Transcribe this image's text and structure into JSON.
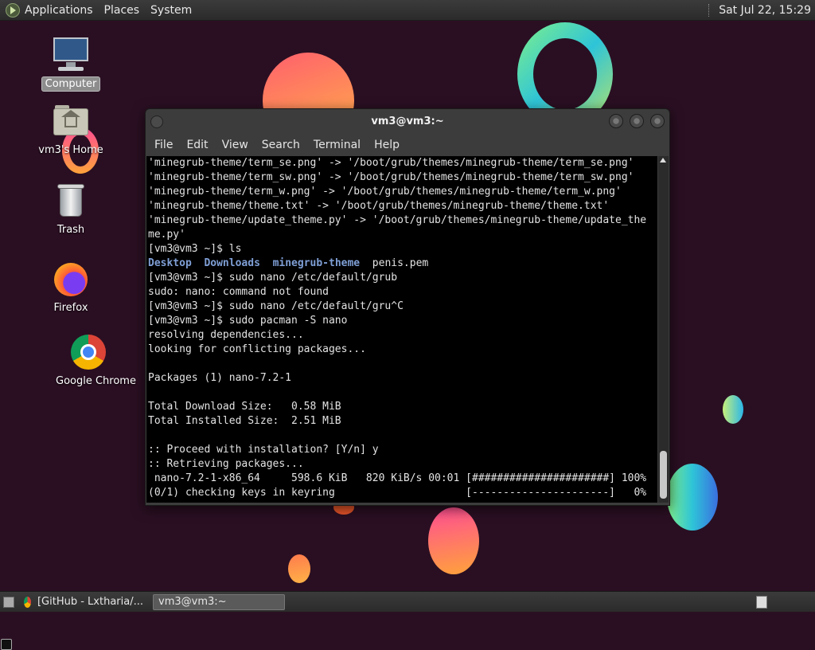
{
  "top_panel": {
    "menus": [
      "Applications",
      "Places",
      "System"
    ],
    "clock": "Sat Jul 22, 15:29"
  },
  "desktop_icons": [
    {
      "label": "Computer",
      "icon": "computer-icon"
    },
    {
      "label": "vm3's Home",
      "icon": "home-folder-icon"
    },
    {
      "label": "Trash",
      "icon": "trash-icon"
    },
    {
      "label": "Firefox",
      "icon": "firefox-icon"
    },
    {
      "label": "Google Chrome",
      "icon": "chrome-icon"
    }
  ],
  "terminal": {
    "title": "vm3@vm3:~",
    "menu": [
      "File",
      "Edit",
      "View",
      "Search",
      "Terminal",
      "Help"
    ],
    "lines": [
      "'minegrub-theme/term_se.png' -> '/boot/grub/themes/minegrub-theme/term_se.png'",
      "'minegrub-theme/term_sw.png' -> '/boot/grub/themes/minegrub-theme/term_sw.png'",
      "'minegrub-theme/term_w.png' -> '/boot/grub/themes/minegrub-theme/term_w.png'",
      "'minegrub-theme/theme.txt' -> '/boot/grub/themes/minegrub-theme/theme.txt'",
      "'minegrub-theme/update_theme.py' -> '/boot/grub/themes/minegrub-theme/update_the",
      "me.py'",
      "[vm3@vm3 ~]$ ls",
      "",
      "[vm3@vm3 ~]$ sudo nano /etc/default/grub",
      "sudo: nano: command not found",
      "[vm3@vm3 ~]$ sudo nano /etc/default/gru^C",
      "[vm3@vm3 ~]$ sudo pacman -S nano",
      "resolving dependencies...",
      "looking for conflicting packages...",
      "",
      "Packages (1) nano-7.2-1",
      "",
      "Total Download Size:   0.58 MiB",
      "Total Installed Size:  2.51 MiB",
      "",
      ":: Proceed with installation? [Y/n] y",
      ":: Retrieving packages...",
      " nano-7.2-1-x86_64     598.6 KiB   820 KiB/s 00:01 [######################] 100%",
      "(0/1) checking keys in keyring                     [----------------------]   0%"
    ],
    "ls_output": {
      "dirs": [
        "Desktop",
        "Downloads",
        "minegrub-theme"
      ],
      "files": [
        "penis.pem"
      ]
    }
  },
  "taskbar": {
    "tasks": [
      {
        "label": "[GitHub - Lxtharia/...",
        "icon": "chrome-icon",
        "active": false
      },
      {
        "label": "vm3@vm3:~",
        "icon": "terminal-icon",
        "active": true
      }
    ]
  }
}
